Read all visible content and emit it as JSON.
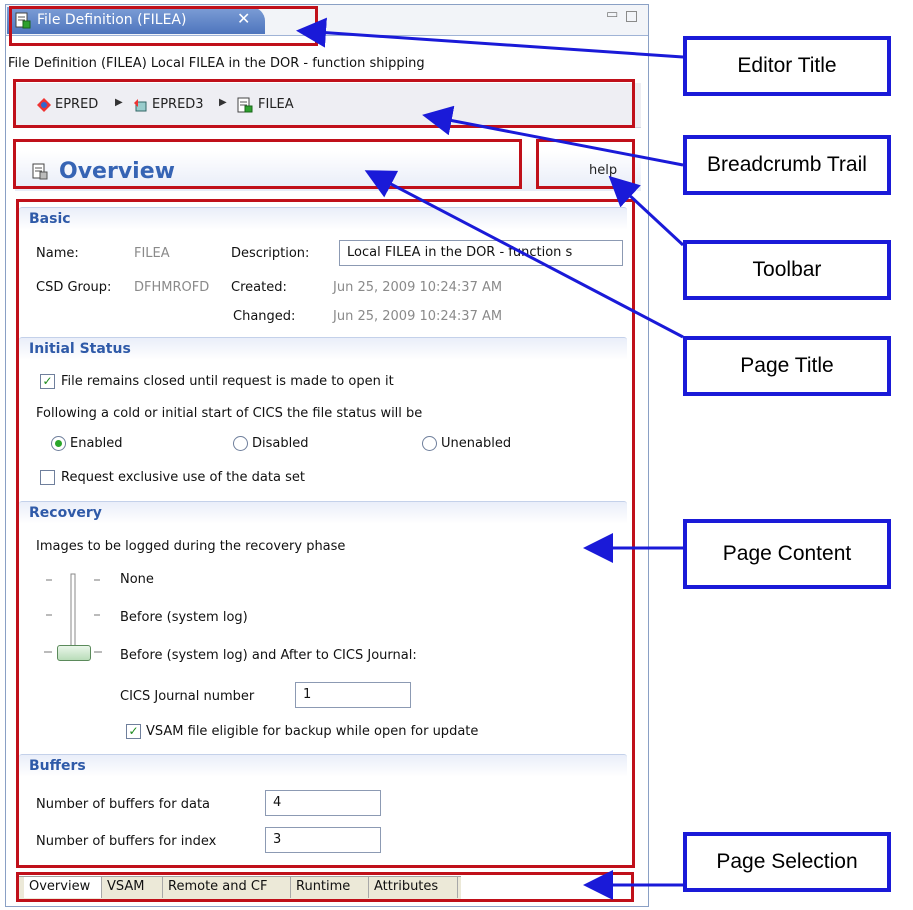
{
  "editor": {
    "tab_title": "File Definition (FILEA)",
    "tab_close": "✕",
    "subtitle": "File Definition (FILEA) Local FILEA in the DOR - function shipping"
  },
  "breadcrumb": {
    "items": [
      {
        "label": "EPRED"
      },
      {
        "label": "EPRED3"
      },
      {
        "label": "FILEA"
      }
    ]
  },
  "page": {
    "title": "Overview",
    "help_label": "help"
  },
  "basic": {
    "heading": "Basic",
    "name_label": "Name:",
    "name_value": "FILEA",
    "description_label": "Description:",
    "description_value": "Local FILEA in the DOR - function s",
    "csd_group_label": "CSD Group:",
    "csd_group_value": "DFHMROFD",
    "created_label": "Created:",
    "created_value": "Jun 25, 2009 10:24:37 AM",
    "changed_label": "Changed:",
    "changed_value": "Jun 25, 2009 10:24:37 AM"
  },
  "initial_status": {
    "heading": "Initial Status",
    "remains_closed_label": "File remains closed until request is made to open it",
    "remains_closed_checked": true,
    "cold_start_text": "Following a cold or initial start of CICS the file status will be",
    "options": [
      {
        "label": "Enabled",
        "selected": true
      },
      {
        "label": "Disabled",
        "selected": false
      },
      {
        "label": "Unenabled",
        "selected": false
      }
    ],
    "exclusive_label": "Request exclusive use of the data set",
    "exclusive_checked": false
  },
  "recovery": {
    "heading": "Recovery",
    "images_text": "Images to be logged during the recovery phase",
    "levels": [
      "None",
      "Before (system log)",
      "Before (system log) and After to CICS Journal:"
    ],
    "journal_label": "CICS Journal number",
    "journal_value": "1",
    "backup_label": "VSAM file eligible for backup while open for update",
    "backup_checked": true
  },
  "buffers": {
    "heading": "Buffers",
    "data_label": "Number of buffers for data",
    "data_value": "4",
    "index_label": "Number of buffers for index",
    "index_value": "3"
  },
  "page_tabs": [
    "Overview",
    "VSAM",
    "Remote and CF",
    "Runtime",
    "Attributes"
  ],
  "callouts": {
    "editor_title": "Editor Title",
    "breadcrumb_trail": "Breadcrumb Trail",
    "toolbar": "Toolbar",
    "page_title": "Page Title",
    "page_content": "Page Content",
    "page_selection": "Page Selection"
  },
  "colors": {
    "annotation_red": "#c0101a",
    "callout_blue": "#1a1ad8",
    "section_heading": "#2f5aa8",
    "checkmark_green": "#1c8a1c"
  }
}
